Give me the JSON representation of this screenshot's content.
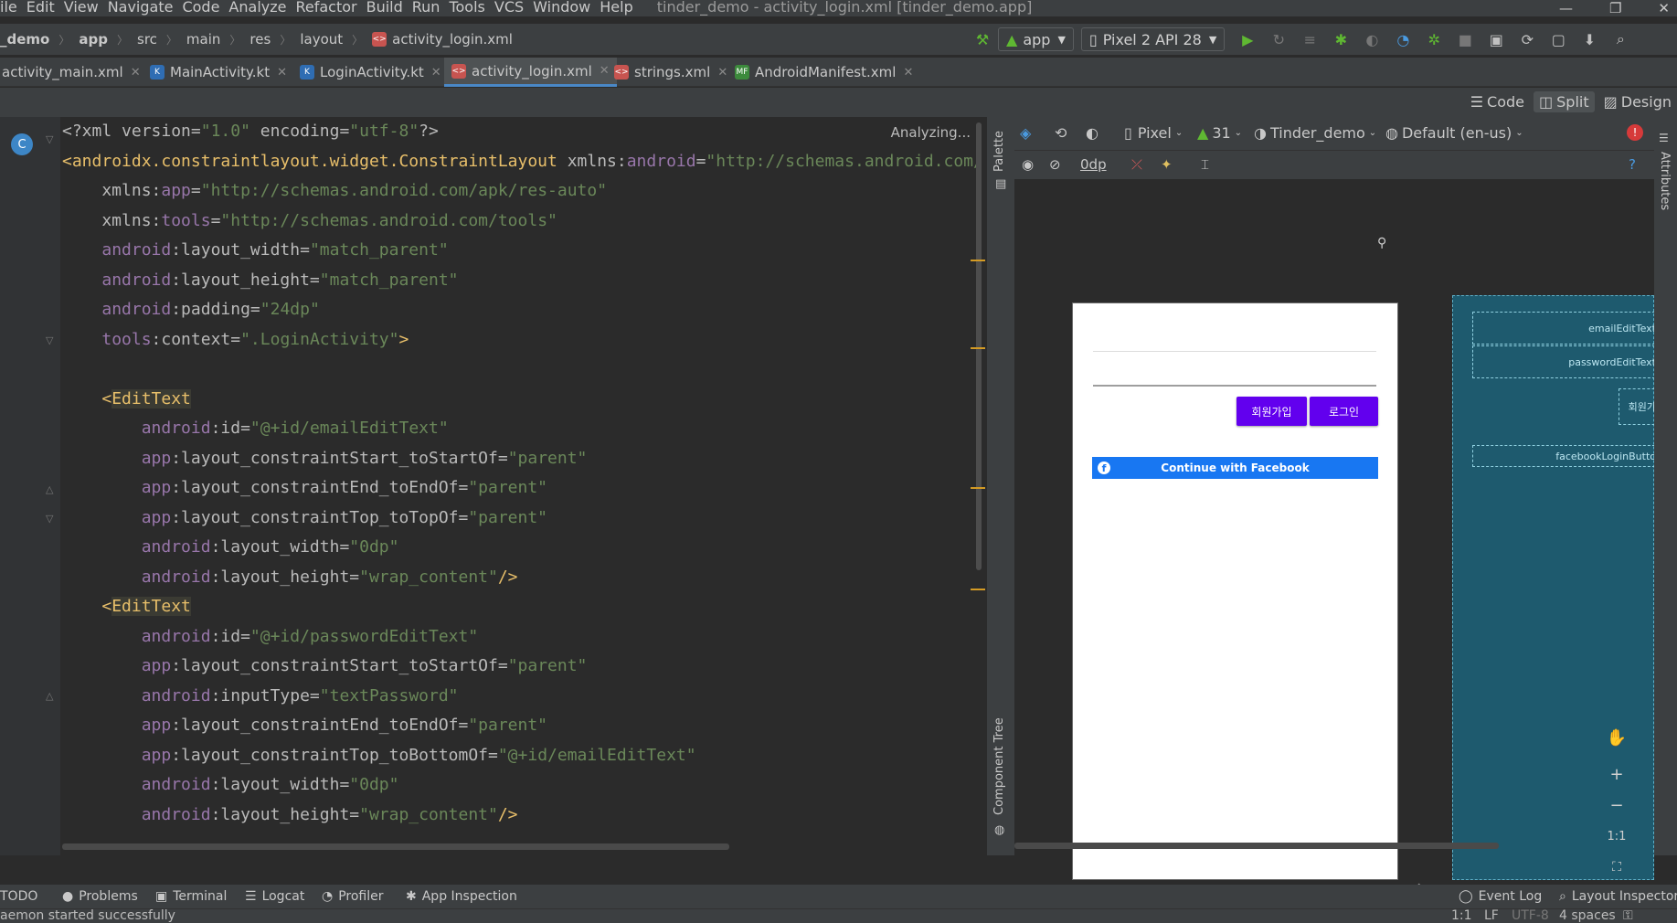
{
  "menubar": {
    "items": [
      "ile",
      "Edit",
      "View",
      "Navigate",
      "Code",
      "Analyze",
      "Refactor",
      "Build",
      "Run",
      "Tools",
      "VCS",
      "Window",
      "Help"
    ],
    "window_title": "tinder_demo - activity_login.xml [tinder_demo.app]"
  },
  "breadcrumbs": [
    "_demo",
    "app",
    "src",
    "main",
    "res",
    "layout",
    "activity_login.xml"
  ],
  "toolbar": {
    "run_config": "app",
    "device": "Pixel 2 API 28"
  },
  "tabs": [
    {
      "label": "activity_main.xml",
      "icon": "xml-file-icon"
    },
    {
      "label": "MainActivity.kt",
      "icon": "kotlin-file-icon"
    },
    {
      "label": "LoginActivity.kt",
      "icon": "kotlin-file-icon"
    },
    {
      "label": "activity_login.xml",
      "icon": "xml-file-icon",
      "active": true
    },
    {
      "label": "strings.xml",
      "icon": "xml-file-icon"
    },
    {
      "label": "AndroidManifest.xml",
      "icon": "manifest-file-icon"
    }
  ],
  "view_modes": {
    "code": "Code",
    "split": "Split",
    "design": "Design"
  },
  "editor": {
    "status": "Analyzing...",
    "lines": [
      [
        {
          "t": "<",
          "c": "pi"
        },
        {
          "t": "?xml version=",
          "c": "pi"
        },
        {
          "t": "\"1.0\"",
          "c": "val"
        },
        {
          "t": " encoding=",
          "c": "pi"
        },
        {
          "t": "\"utf-8\"",
          "c": "val"
        },
        {
          "t": "?>",
          "c": "pi"
        }
      ],
      [
        {
          "t": "<",
          "c": "pun"
        },
        {
          "t": "androidx.constraintlayout.widget.ConstraintLayout",
          "c": "tag"
        },
        {
          "t": " xmlns:",
          "c": "at"
        },
        {
          "t": "android",
          "c": "ns"
        },
        {
          "t": "=",
          "c": "at"
        },
        {
          "t": "\"http://schemas.android.com/apk/res/android\"",
          "c": "val"
        }
      ],
      [
        {
          "t": "    xmlns:",
          "c": "at"
        },
        {
          "t": "app",
          "c": "ns"
        },
        {
          "t": "=",
          "c": "at"
        },
        {
          "t": "\"http://schemas.android.com/apk/res-auto\"",
          "c": "val"
        }
      ],
      [
        {
          "t": "    xmlns:",
          "c": "at"
        },
        {
          "t": "tools",
          "c": "ns"
        },
        {
          "t": "=",
          "c": "at"
        },
        {
          "t": "\"http://schemas.android.com/tools\"",
          "c": "val"
        }
      ],
      [
        {
          "t": "    ",
          "c": "at"
        },
        {
          "t": "android",
          "c": "ns"
        },
        {
          "t": ":layout_width=",
          "c": "at"
        },
        {
          "t": "\"match_parent\"",
          "c": "val"
        }
      ],
      [
        {
          "t": "    ",
          "c": "at"
        },
        {
          "t": "android",
          "c": "ns"
        },
        {
          "t": ":layout_height=",
          "c": "at"
        },
        {
          "t": "\"match_parent\"",
          "c": "val"
        }
      ],
      [
        {
          "t": "    ",
          "c": "at"
        },
        {
          "t": "android",
          "c": "ns"
        },
        {
          "t": ":padding=",
          "c": "at"
        },
        {
          "t": "\"24dp\"",
          "c": "val"
        }
      ],
      [
        {
          "t": "    ",
          "c": "at"
        },
        {
          "t": "tools",
          "c": "ns"
        },
        {
          "t": ":context=",
          "c": "at"
        },
        {
          "t": "\".LoginActivity\"",
          "c": "val"
        },
        {
          "t": ">",
          "c": "pun"
        }
      ],
      [
        {
          "t": "",
          "c": "at"
        }
      ],
      [
        {
          "t": "    <",
          "c": "pun"
        },
        {
          "t": "EditText",
          "c": "tagh"
        }
      ],
      [
        {
          "t": "        ",
          "c": "at"
        },
        {
          "t": "android",
          "c": "ns"
        },
        {
          "t": ":id=",
          "c": "at"
        },
        {
          "t": "\"@+id/emailEditText\"",
          "c": "val"
        }
      ],
      [
        {
          "t": "        ",
          "c": "at"
        },
        {
          "t": "app",
          "c": "ns"
        },
        {
          "t": ":layout_constraintStart_toStartOf=",
          "c": "at"
        },
        {
          "t": "\"parent\"",
          "c": "val"
        }
      ],
      [
        {
          "t": "        ",
          "c": "at"
        },
        {
          "t": "app",
          "c": "ns"
        },
        {
          "t": ":layout_constraintEnd_toEndOf=",
          "c": "at"
        },
        {
          "t": "\"parent\"",
          "c": "val"
        }
      ],
      [
        {
          "t": "        ",
          "c": "at"
        },
        {
          "t": "app",
          "c": "ns"
        },
        {
          "t": ":layout_constraintTop_toTopOf=",
          "c": "at"
        },
        {
          "t": "\"parent\"",
          "c": "val"
        }
      ],
      [
        {
          "t": "        ",
          "c": "at"
        },
        {
          "t": "android",
          "c": "ns"
        },
        {
          "t": ":layout_width=",
          "c": "at"
        },
        {
          "t": "\"0dp\"",
          "c": "val"
        }
      ],
      [
        {
          "t": "        ",
          "c": "at"
        },
        {
          "t": "android",
          "c": "ns"
        },
        {
          "t": ":layout_height=",
          "c": "at"
        },
        {
          "t": "\"wrap_content\"",
          "c": "val"
        },
        {
          "t": "/>",
          "c": "pun"
        }
      ],
      [
        {
          "t": "    <",
          "c": "pun"
        },
        {
          "t": "EditText",
          "c": "tagh"
        }
      ],
      [
        {
          "t": "        ",
          "c": "at"
        },
        {
          "t": "android",
          "c": "ns"
        },
        {
          "t": ":id=",
          "c": "at"
        },
        {
          "t": "\"@+id/passwordEditText\"",
          "c": "val"
        }
      ],
      [
        {
          "t": "        ",
          "c": "at"
        },
        {
          "t": "app",
          "c": "ns"
        },
        {
          "t": ":layout_constraintStart_toStartOf=",
          "c": "at"
        },
        {
          "t": "\"parent\"",
          "c": "val"
        }
      ],
      [
        {
          "t": "        ",
          "c": "at"
        },
        {
          "t": "android",
          "c": "ns"
        },
        {
          "t": ":inputType=",
          "c": "at"
        },
        {
          "t": "\"textPassword\"",
          "c": "val"
        }
      ],
      [
        {
          "t": "        ",
          "c": "at"
        },
        {
          "t": "app",
          "c": "ns"
        },
        {
          "t": ":layout_constraintEnd_toEndOf=",
          "c": "at"
        },
        {
          "t": "\"parent\"",
          "c": "val"
        }
      ],
      [
        {
          "t": "        ",
          "c": "at"
        },
        {
          "t": "app",
          "c": "ns"
        },
        {
          "t": ":layout_constraintTop_toBottomOf=",
          "c": "at"
        },
        {
          "t": "\"@+id/emailEditText\"",
          "c": "val"
        }
      ],
      [
        {
          "t": "        ",
          "c": "at"
        },
        {
          "t": "android",
          "c": "ns"
        },
        {
          "t": ":layout_width=",
          "c": "at"
        },
        {
          "t": "\"0dp\"",
          "c": "val"
        }
      ],
      [
        {
          "t": "        ",
          "c": "at"
        },
        {
          "t": "android",
          "c": "ns"
        },
        {
          "t": ":layout_height=",
          "c": "at"
        },
        {
          "t": "\"wrap_content\"",
          "c": "val"
        },
        {
          "t": "/>",
          "c": "pun"
        }
      ]
    ]
  },
  "side_panels": {
    "palette": "Palette",
    "component_tree": "Component Tree",
    "attributes": "Attributes"
  },
  "designer": {
    "device": "Pixel",
    "api": "31",
    "theme": "Tinder_demo",
    "locale": "Default (en-us)",
    "margin": "0dp",
    "preview": {
      "signup_button": "회원가입",
      "login_button": "로그인",
      "facebook_button": "Continue with Facebook"
    },
    "blueprint": {
      "email": "emailEditText",
      "password": "passwordEditText",
      "signup": "회원가",
      "facebook": "facebookLoginButto"
    },
    "zoom_one": "1:1"
  },
  "bottom_tools": [
    "TODO",
    "Problems",
    "Terminal",
    "Logcat",
    "Profiler",
    "App Inspection"
  ],
  "bottom_right_tools": [
    "Event Log",
    "Layout Inspector"
  ],
  "status": {
    "message": "aemon started successfully",
    "position": "1:1",
    "line_ending": "LF",
    "encoding": "UTF-8",
    "indent": "4 spaces"
  },
  "colors": {
    "accent": "#6200ee",
    "facebook": "#1877f2",
    "blueprint": "#1e5a6e"
  }
}
